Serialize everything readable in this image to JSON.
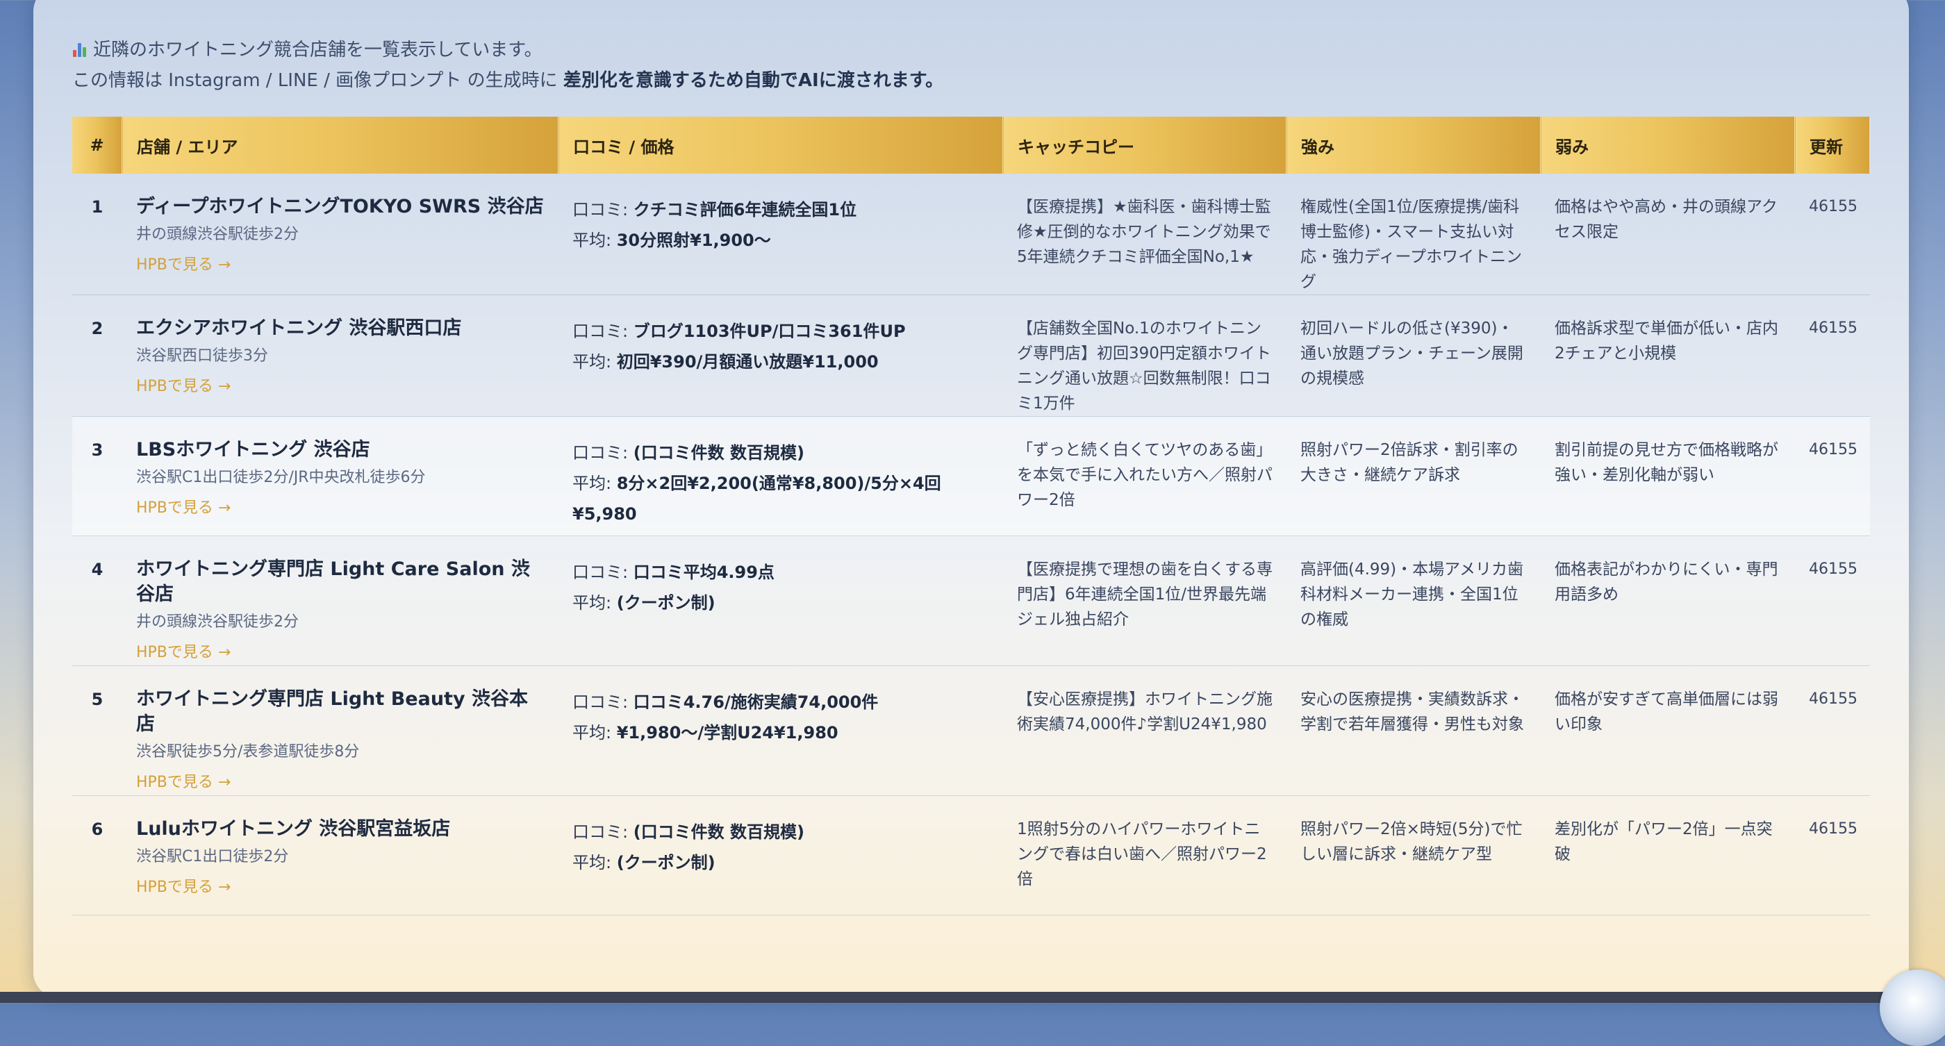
{
  "intro": {
    "icon": "bar-chart-icon",
    "line1": "近隣のホワイトニング競合店舗を一覧表示しています。",
    "line2_pre": "この情報は Instagram / LINE / 画像プロンプト の生成時に ",
    "line2_bold": "差別化を意識するため自動でAIに渡されます。"
  },
  "table": {
    "headers": {
      "num": "#",
      "shop": "店舗 / エリア",
      "reviews": "口コミ / 価格",
      "catch": "キャッチコピー",
      "strengths": "強み",
      "weaknesses": "弱み",
      "updated": "更新"
    },
    "review_prefix": "口コミ: ",
    "price_prefix": "平均: ",
    "link_label": "HPBで見る →",
    "rows": [
      {
        "num": "1",
        "name": "ディープホワイトニングTOKYO SWRS 渋谷店",
        "area": "井の頭線渋谷駅徒歩2分",
        "reviews": "クチコミ評価6年連続全国1位",
        "price": "30分照射¥1,900〜",
        "catch": "【医療提携】★歯科医・歯科博士監修★圧倒的なホワイトニング効果で5年連続クチコミ評価全国No,1★",
        "strengths": "権威性(全国1位/医療提携/歯科博士監修)・スマート支払い対応・強力ディープホワイトニング",
        "weaknesses": "価格はやや高め・井の頭線アクセス限定",
        "updated": "46155"
      },
      {
        "num": "2",
        "name": "エクシアホワイトニング 渋谷駅西口店",
        "area": "渋谷駅西口徒歩3分",
        "reviews": "ブログ1103件UP/口コミ361件UP",
        "price": "初回¥390/月額通い放題¥11,000",
        "catch": "【店舗数全国No.1のホワイトニング専門店】初回390円定額ホワイトニング通い放題☆回数無制限！口コミ1万件",
        "strengths": "初回ハードルの低さ(¥390)・通い放題プラン・チェーン展開の規模感",
        "weaknesses": "価格訴求型で単価が低い・店内2チェアと小規模",
        "updated": "46155"
      },
      {
        "num": "3",
        "name": "LBSホワイトニング 渋谷店",
        "area": "渋谷駅C1出口徒歩2分/JR中央改札徒歩6分",
        "reviews": "(口コミ件数 数百規模)",
        "price": "8分×2回¥2,200(通常¥8,800)/5分×4回¥5,980",
        "catch": "「ずっと続く白くてツヤのある歯」を本気で手に入れたい方へ／照射パワー2倍",
        "strengths": "照射パワー2倍訴求・割引率の大きさ・継続ケア訴求",
        "weaknesses": "割引前提の見せ方で価格戦略が強い・差別化軸が弱い",
        "updated": "46155"
      },
      {
        "num": "4",
        "name": "ホワイトニング専門店 Light Care Salon 渋谷店",
        "area": "井の頭線渋谷駅徒歩2分",
        "reviews": "口コミ平均4.99点",
        "price": "(クーポン制)",
        "catch": "【医療提携で理想の歯を白くする専門店】6年連続全国1位/世界最先端ジェル独占紹介",
        "strengths": "高評価(4.99)・本場アメリカ歯科材料メーカー連携・全国1位の権威",
        "weaknesses": "価格表記がわかりにくい・専門用語多め",
        "updated": "46155"
      },
      {
        "num": "5",
        "name": "ホワイトニング専門店 Light Beauty 渋谷本店",
        "area": "渋谷駅徒歩5分/表参道駅徒歩8分",
        "reviews": "口コミ4.76/施術実績74,000件",
        "price": "¥1,980〜/学割U24¥1,980",
        "catch": "【安心医療提携】ホワイトニング施術実績74,000件♪学割U24¥1,980",
        "strengths": "安心の医療提携・実績数訴求・学割で若年層獲得・男性も対象",
        "weaknesses": "価格が安すぎて高単価層には弱い印象",
        "updated": "46155"
      },
      {
        "num": "6",
        "name": "Luluホワイトニング 渋谷駅宮益坂店",
        "area": "渋谷駅C1出口徒歩2分",
        "reviews": "(口コミ件数 数百規模)",
        "price": "(クーポン制)",
        "catch": "1照射5分のハイパワーホワイトニングで春は白い歯へ／照射パワー2倍",
        "strengths": "照射パワー2倍×時短(5分)で忙しい層に訴求・継続ケア型",
        "weaknesses": "差別化が「パワー2倍」一点突破",
        "updated": "46155"
      }
    ]
  },
  "colors": {
    "header_gold_start": "#f6d67c",
    "header_gold_end": "#d6a23a",
    "link_gold": "#d4a03a",
    "text_dark": "#1e2a40"
  }
}
